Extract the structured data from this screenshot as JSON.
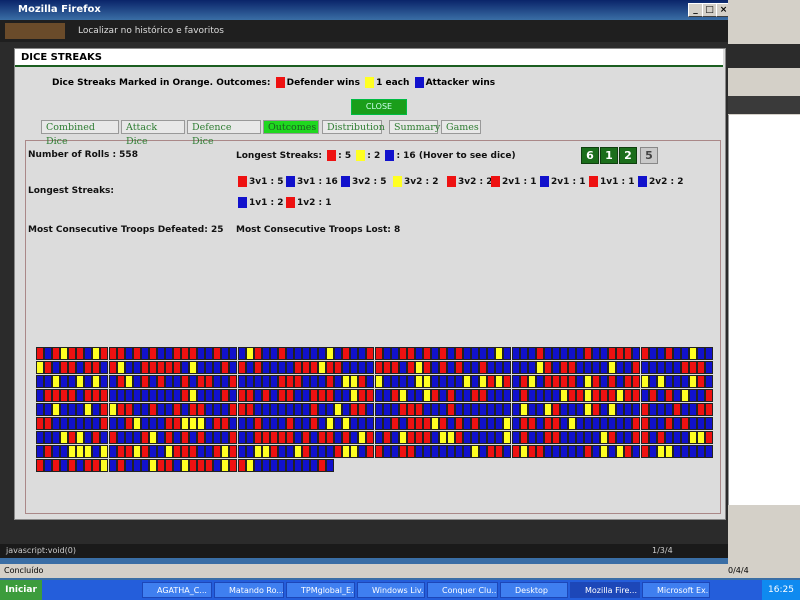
{
  "window": {
    "title": "Mozilla Firefox"
  },
  "toolbar": {
    "history_placeholder": "Localizar no histórico e favoritos"
  },
  "modal": {
    "title": "DICE STREAKS",
    "legend_intro": "Dice Streaks Marked in Orange. Outcomes:",
    "legend_defender": "Defender wins",
    "legend_each": "1 each",
    "legend_attacker": "Attacker wins",
    "close_label": "CLOSE",
    "colors": {
      "defender": "#ee1111",
      "each": "#ffff22",
      "attacker": "#1111cc",
      "active_tab": "#1fd81f"
    }
  },
  "tabs": [
    {
      "label": "Combined Dice"
    },
    {
      "label": "Attack Dice"
    },
    {
      "label": "Defence Dice"
    },
    {
      "label": "Outcomes",
      "active": true
    },
    {
      "label": "Distribution"
    },
    {
      "label": "Summary"
    },
    {
      "label": "Games"
    }
  ],
  "stats": {
    "number_of_rolls_label": "Number of Rolls : 558",
    "longest_streaks_label": "Longest Streaks:",
    "longest_streaks_top_label": "Longest Streaks:",
    "longest_streaks_red": ": 5",
    "longest_streaks_yellow": ": 2",
    "longest_streaks_blue": ": 16  (Hover to see dice)",
    "most_defeated": "Most Consecutive Troops Defeated: 25",
    "most_lost": "Most Consecutive Troops Lost: 8",
    "dice_badges": [
      "6",
      "1",
      "2",
      "5"
    ]
  },
  "streaks": [
    {
      "label": "3v1 : 5",
      "color": "red"
    },
    {
      "label": "3v1 : 16",
      "color": "blue"
    },
    {
      "label": "3v2 : 5",
      "color": "blue"
    },
    {
      "label": "3v2 : 2",
      "color": "yellow"
    },
    {
      "label": "3v2 : 2",
      "color": "red"
    },
    {
      "label": "2v1 : 1",
      "color": "red"
    },
    {
      "label": "2v1 : 1",
      "color": "blue"
    },
    {
      "label": "1v1 : 1",
      "color": "red"
    },
    {
      "label": "2v2 : 2",
      "color": "blue"
    },
    {
      "label": "1v1 : 2",
      "color": "blue"
    },
    {
      "label": "1v2 : 1",
      "color": "red"
    }
  ],
  "grid": {
    "columns": 84,
    "full_rows": 8,
    "last_row_cells": 37,
    "pattern_seed": "RBRBBYRB"
  },
  "status": {
    "text": "javascript:void(0)",
    "page_counter": "1/3/4",
    "bottom_text": "Concluído",
    "bottom_counter": "0/4/4"
  },
  "taskbar": {
    "start": "Iniciar",
    "items": [
      "AGATHA_C...",
      "Matando Ro...",
      "TPMglobal_E...",
      "Windows Liv...",
      "Conquer Clu...",
      "Desktop",
      "Mozilla Fire...",
      "Microsoft Ex..."
    ],
    "clock": "16:25"
  }
}
